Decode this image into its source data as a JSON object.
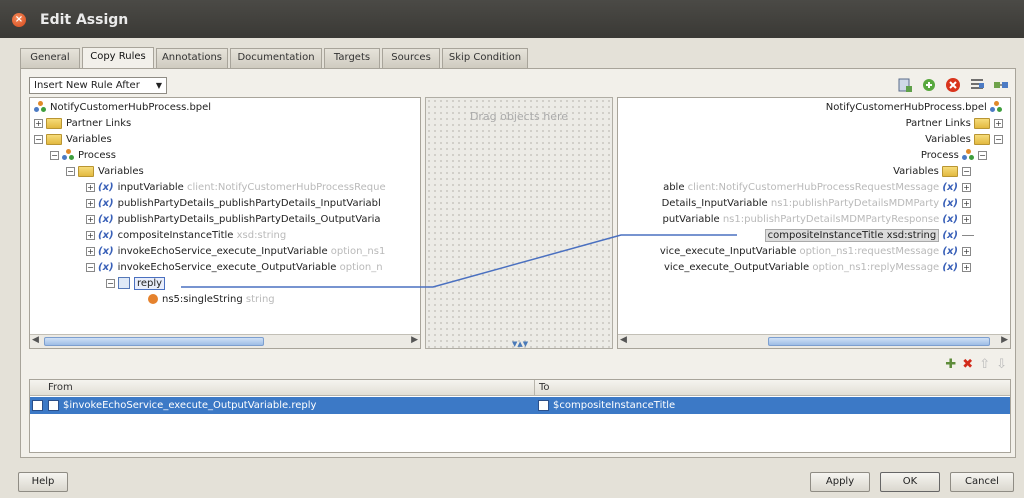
{
  "window": {
    "title": "Edit Assign"
  },
  "tabs": [
    "General",
    "Copy Rules",
    "Annotations",
    "Documentation",
    "Targets",
    "Sources",
    "Skip Condition"
  ],
  "active_tab": "Copy Rules",
  "toolbar": {
    "insert_rule_dropdown": "Insert New Rule After"
  },
  "source_tree": {
    "root": "NotifyCustomerHubProcess.bpel",
    "partner_links": "Partner Links",
    "variables": "Variables",
    "process": "Process",
    "process_variables": "Variables",
    "vars": [
      {
        "name": "inputVariable",
        "type": "client:NotifyCustomerHubProcessReque"
      },
      {
        "name": "publishPartyDetails_publishPartyDetails_InputVariabl",
        "type": ""
      },
      {
        "name": "publishPartyDetails_publishPartyDetails_OutputVaria",
        "type": ""
      },
      {
        "name": "compositeInstanceTitle",
        "type": "xsd:string"
      },
      {
        "name": "invokeEchoService_execute_InputVariable",
        "type": "option_ns1"
      },
      {
        "name": "invokeEchoService_execute_OutputVariable",
        "type": "option_n"
      }
    ],
    "reply": "reply",
    "single_string": {
      "name": "ns5:singleString",
      "type": "string"
    }
  },
  "middle": {
    "hint": "Drag objects here"
  },
  "target_tree": {
    "root": "NotifyCustomerHubProcess.bpel",
    "partner_links": "Partner Links",
    "variables": "Variables",
    "process": "Process",
    "process_variables": "Variables",
    "vars": [
      {
        "name": "able",
        "type": "client:NotifyCustomerHubProcessRequestMessage"
      },
      {
        "name": "Details_InputVariable",
        "type": "ns1:publishPartyDetailsMDMParty"
      },
      {
        "name": "putVariable",
        "type": "ns1:publishPartyDetailsMDMPartyResponse"
      },
      {
        "name": "compositeInstanceTitle xsd:string",
        "type": ""
      },
      {
        "name": "vice_execute_InputVariable",
        "type": "option_ns1:requestMessage"
      },
      {
        "name": "vice_execute_OutputVariable",
        "type": "option_ns1:replyMessage"
      }
    ]
  },
  "rules_table": {
    "headers": {
      "from": "From",
      "to": "To"
    },
    "rows": [
      {
        "from": "$invokeEchoService_execute_OutputVariable.reply",
        "to": "$compositeInstanceTitle"
      }
    ]
  },
  "buttons": {
    "help": "Help",
    "apply": "Apply",
    "ok": "OK",
    "cancel": "Cancel"
  },
  "colors": {
    "selection": "#3c79c6",
    "mapping_line": "#4a70c0"
  }
}
